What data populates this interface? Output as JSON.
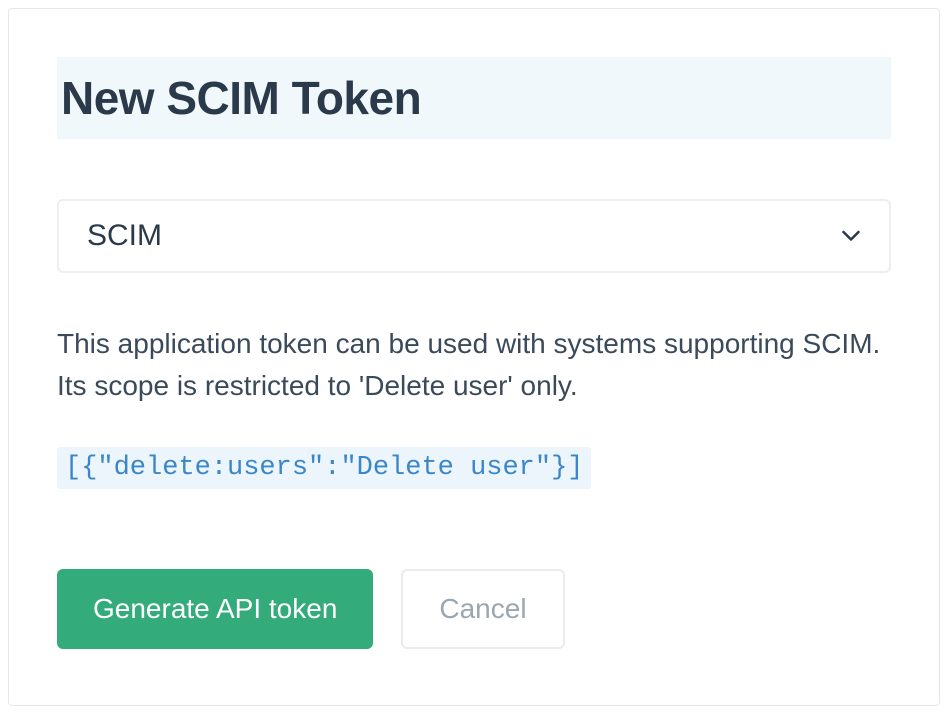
{
  "header": {
    "title": "New SCIM Token"
  },
  "form": {
    "select_value": "SCIM",
    "description": "This application token can be used with systems supporting SCIM. Its scope is restricted to 'Delete user' only.",
    "scope_json": "[{\"delete:users\":\"Delete user\"}]"
  },
  "buttons": {
    "generate_label": "Generate API token",
    "cancel_label": "Cancel"
  }
}
